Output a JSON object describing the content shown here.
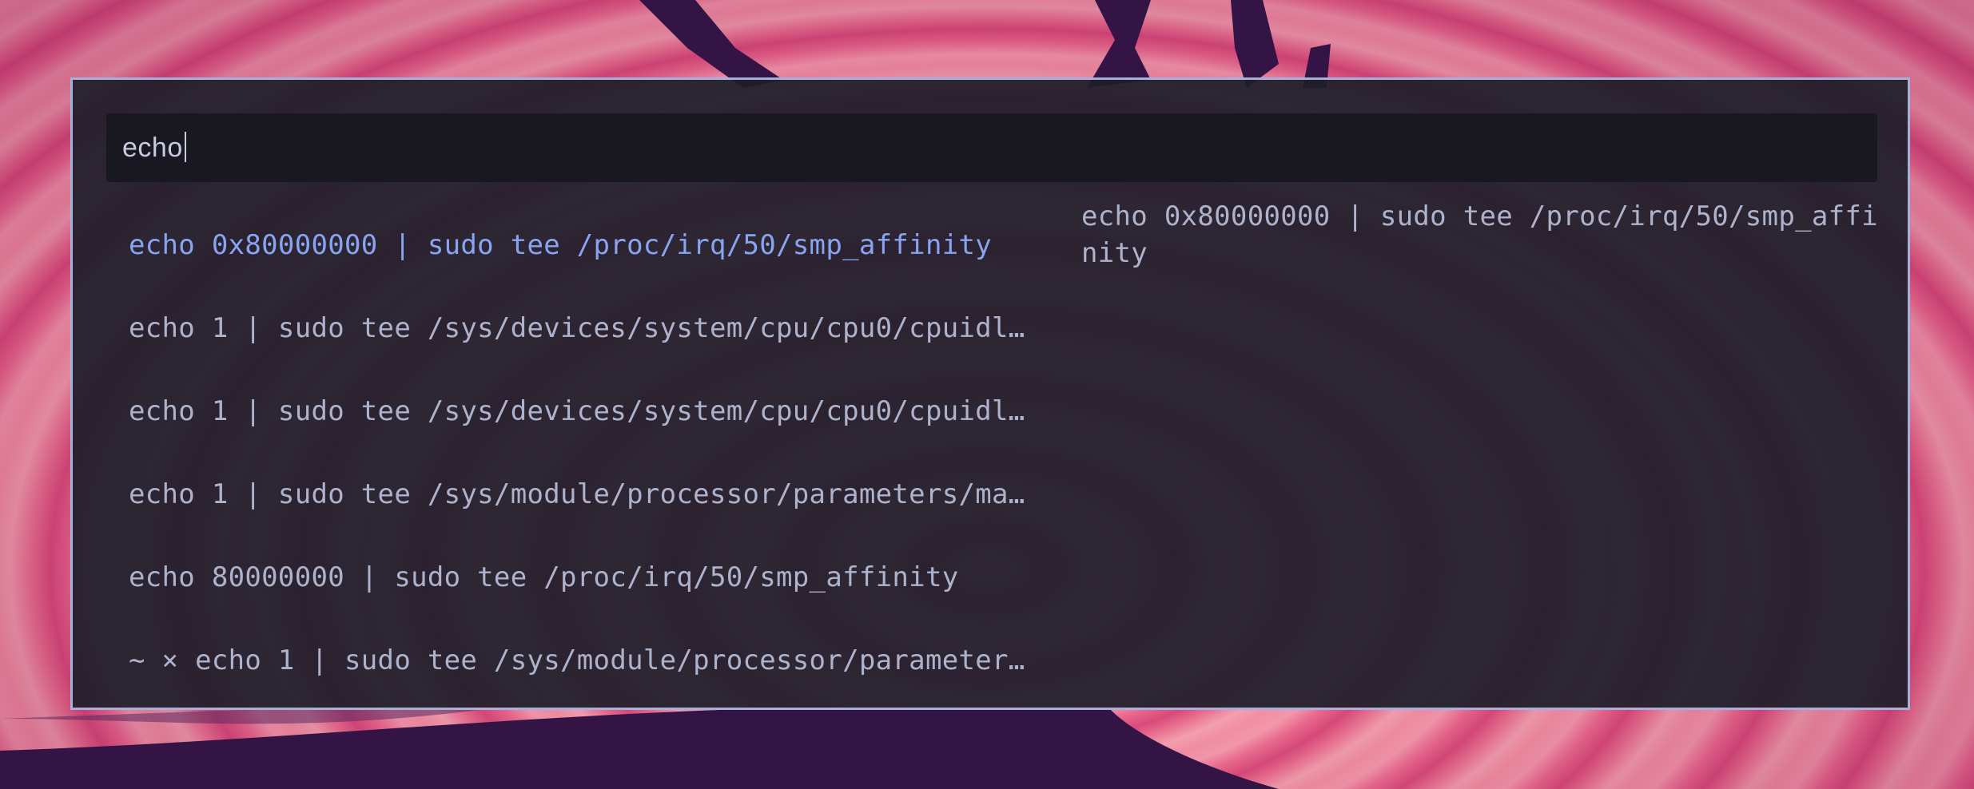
{
  "search": {
    "value": "echo"
  },
  "results": [
    {
      "label": "echo 0x80000000 | sudo tee /proc/irq/50/smp_affinity",
      "selected": true
    },
    {
      "label": "echo 1 | sudo tee /sys/devices/system/cpu/cpu0/cpuidl…",
      "selected": false
    },
    {
      "label": "echo 1 | sudo tee /sys/devices/system/cpu/cpu0/cpuidl…",
      "selected": false
    },
    {
      "label": "echo 1 | sudo tee /sys/module/processor/parameters/ma…",
      "selected": false
    },
    {
      "label": "echo 80000000 | sudo tee /proc/irq/50/smp_affinity",
      "selected": false
    },
    {
      "label": "~ × echo 1 | sudo tee /sys/module/processor/parameter…",
      "selected": false
    }
  ],
  "preview": {
    "text": "echo 0x80000000 | sudo tee /proc/irq/50/smp_affinity"
  },
  "colors": {
    "accent": "#89a4f2",
    "border": "#a6b0d8",
    "text": "#aeb3cd",
    "panel": "#1e1e2a"
  }
}
